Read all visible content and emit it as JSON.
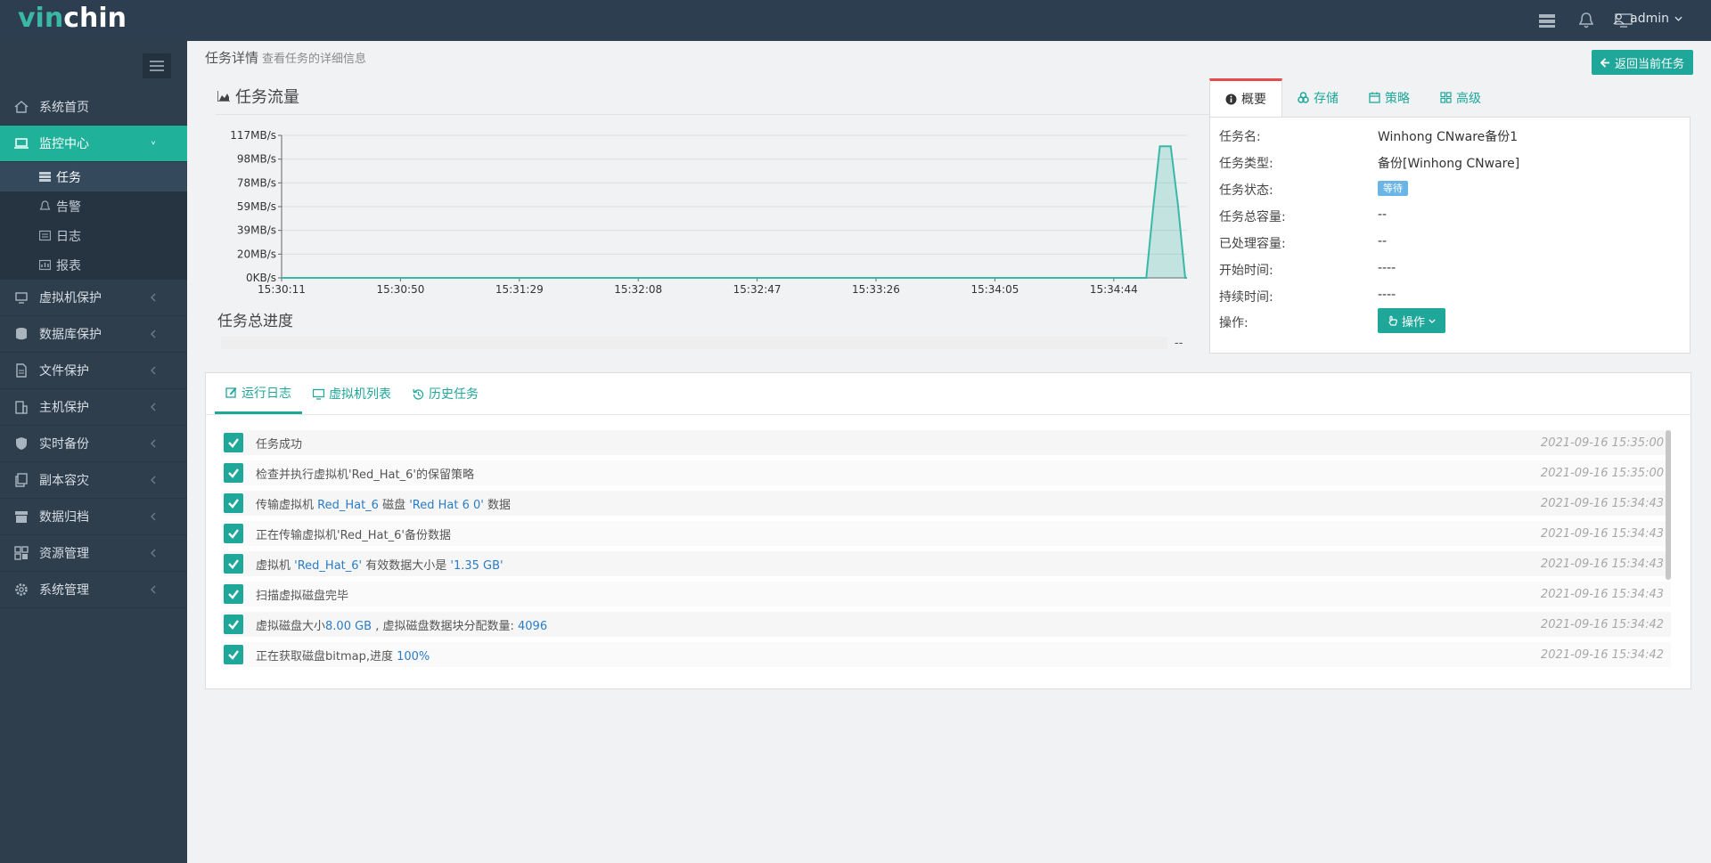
{
  "app": {
    "logo_a": "vin",
    "logo_b": "chin",
    "user": "admin"
  },
  "sidebar": {
    "items": [
      {
        "label": "系统首页",
        "icon": "home-icon"
      },
      {
        "label": "监控中心",
        "icon": "monitor-icon",
        "active": true
      },
      {
        "label": "虚拟机保护",
        "icon": "vm-icon"
      },
      {
        "label": "数据库保护",
        "icon": "database-icon"
      },
      {
        "label": "文件保护",
        "icon": "file-icon"
      },
      {
        "label": "主机保护",
        "icon": "host-icon"
      },
      {
        "label": "实时备份",
        "icon": "shield-icon"
      },
      {
        "label": "副本容灾",
        "icon": "copy-icon"
      },
      {
        "label": "数据归档",
        "icon": "archive-icon"
      },
      {
        "label": "资源管理",
        "icon": "grid-icon"
      },
      {
        "label": "系统管理",
        "icon": "gear-icon"
      }
    ],
    "subitems": [
      {
        "label": "任务",
        "icon": "task-icon"
      },
      {
        "label": "告警",
        "icon": "bell-icon"
      },
      {
        "label": "日志",
        "icon": "log-icon"
      },
      {
        "label": "报表",
        "icon": "report-icon"
      }
    ]
  },
  "page": {
    "title": "任务详情",
    "subtitle": "查看任务的详细信息",
    "back_label": "返回当前任务"
  },
  "flow": {
    "title": "任务流量",
    "progress_title": "任务总进度",
    "progress_value": "--"
  },
  "chart_data": {
    "type": "area",
    "title": "任务流量",
    "x": [
      "15:30:11",
      "15:30:50",
      "15:31:29",
      "15:32:08",
      "15:32:47",
      "15:33:26",
      "15:34:05",
      "15:34:44"
    ],
    "y_ticks": [
      "0KB/s",
      "20MB/s",
      "39MB/s",
      "59MB/s",
      "78MB/s",
      "98MB/s",
      "117MB/s"
    ],
    "ylim": [
      0,
      117
    ],
    "series": [
      {
        "points": [
          [
            0,
            0
          ],
          [
            0.955,
            0
          ],
          [
            0.963,
            60
          ],
          [
            0.97,
            108
          ],
          [
            0.982,
            108
          ],
          [
            0.99,
            60
          ],
          [
            0.998,
            0
          ],
          [
            1.0,
            0
          ]
        ]
      }
    ],
    "color": "#39b8a8",
    "grid": true
  },
  "panel": {
    "tabs": [
      "概要",
      "存储",
      "策略",
      "高级"
    ],
    "rows": [
      {
        "label": "任务名:",
        "value": "Winhong CNware备份1"
      },
      {
        "label": "任务类型:",
        "value": "备份[Winhong CNware]"
      },
      {
        "label": "任务状态:",
        "value": "等待"
      },
      {
        "label": "任务总容量:",
        "value": "--"
      },
      {
        "label": "已处理容量:",
        "value": "--"
      },
      {
        "label": "开始时间:",
        "value": "----"
      },
      {
        "label": "持续时间:",
        "value": "----"
      },
      {
        "label": "操作:",
        "value": "操作"
      }
    ]
  },
  "logs": {
    "tabs": [
      "运行日志",
      "虚拟机列表",
      "历史任务"
    ],
    "rows": [
      {
        "text": "任务成功",
        "time": "2021-09-16 15:35:00"
      },
      {
        "text": "检查并执行虚拟机'Red_Hat_6'的保留策略",
        "time": "2021-09-16 15:35:00"
      },
      {
        "pre": "传输虚拟机 ",
        "h1": "Red_Hat_6",
        "mid": " 磁盘 ",
        "h2": "'Red Hat 6 0'",
        "post": " 数据",
        "time": "2021-09-16 15:34:43"
      },
      {
        "text": "正在传输虚拟机'Red_Hat_6'备份数据",
        "time": "2021-09-16 15:34:43"
      },
      {
        "pre": "虚拟机 ",
        "h1": "'Red_Hat_6'",
        "mid": " 有效数据大小是 ",
        "h2": "'1.35 GB'",
        "post": "",
        "time": "2021-09-16 15:34:43"
      },
      {
        "text": "扫描虚拟磁盘完毕",
        "time": "2021-09-16 15:34:43"
      },
      {
        "pre": "虚拟磁盘大小",
        "h1": "8.00 GB",
        "mid": " , 虚拟磁盘数据块分配数量: ",
        "h2": "4096",
        "post": "",
        "time": "2021-09-16 15:34:42"
      },
      {
        "pre": "正在获取磁盘bitmap,进度 ",
        "h1": "100%",
        "mid": "",
        "h2": "",
        "post": "",
        "time": "2021-09-16 15:34:42"
      }
    ]
  }
}
